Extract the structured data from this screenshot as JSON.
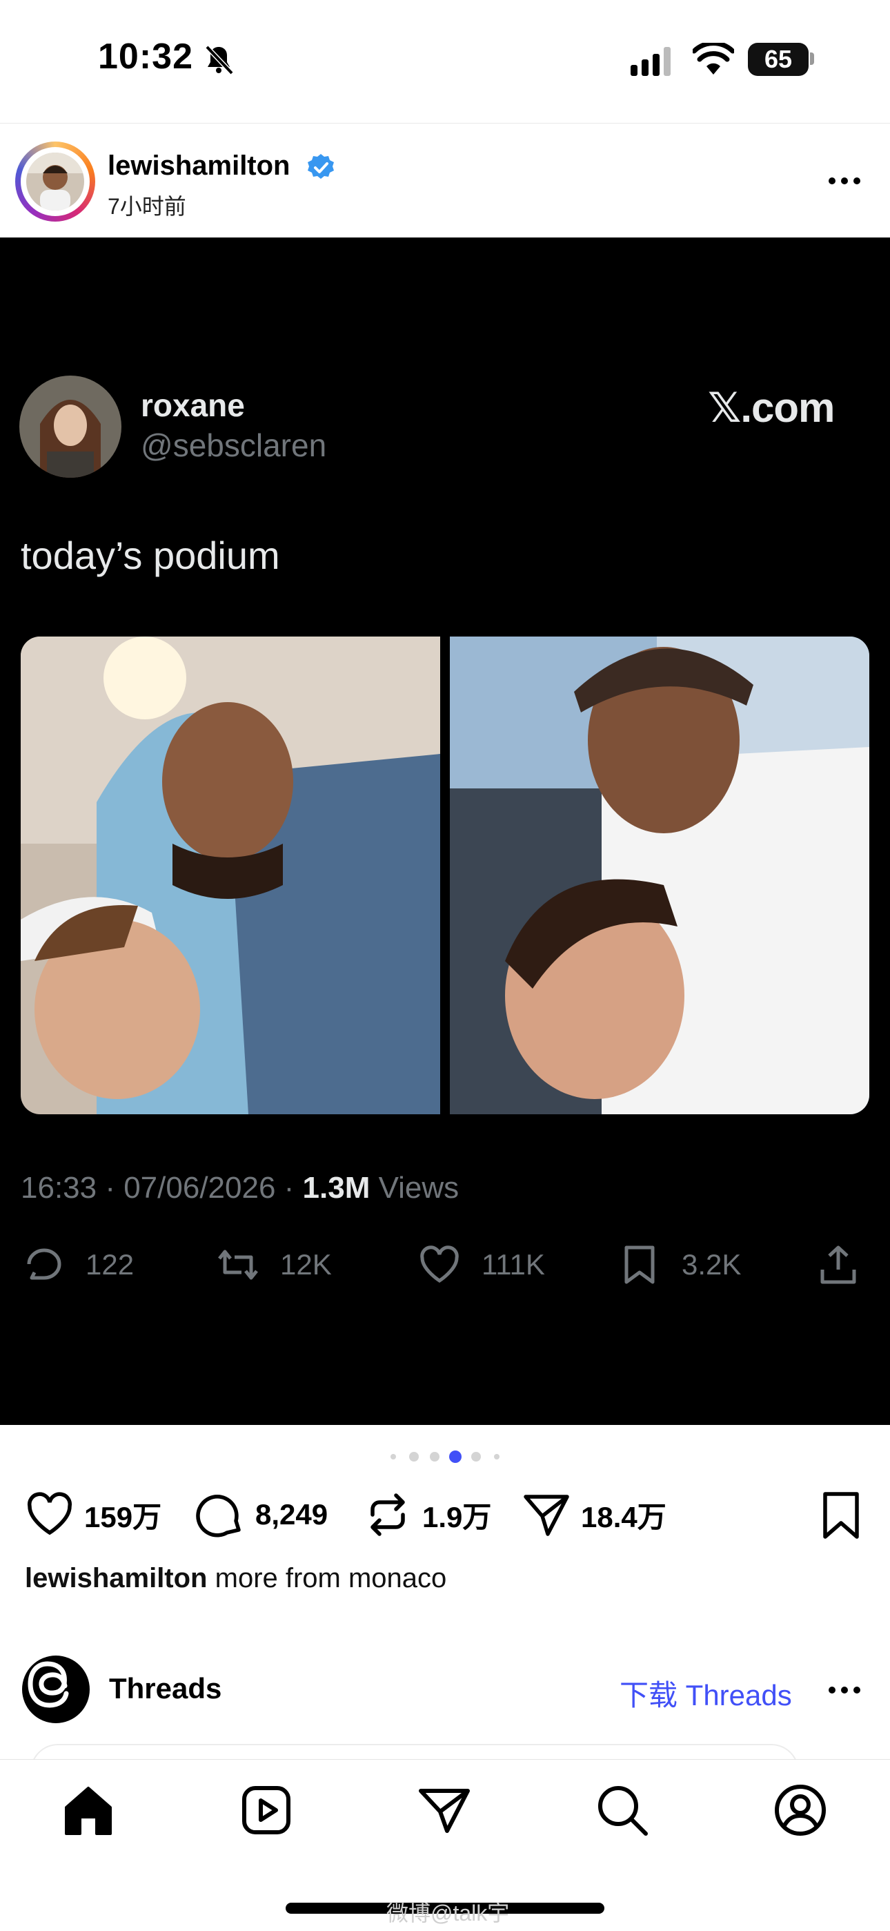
{
  "status_bar": {
    "time": "10:32",
    "battery": "65"
  },
  "post": {
    "author": "lewishamilton",
    "time_ago": "7小时前",
    "caption_author": "lewishamilton",
    "caption_text": "more from monaco"
  },
  "tweet": {
    "name": "roxane",
    "handle": "@sebsclaren",
    "source": "𝕏.com",
    "text": "today’s podium",
    "emojis": "😭😭😭😭😭",
    "meta_time": "16:33 · 07/06/2026 · ",
    "views_count": "1.3M",
    "views_label": " Views",
    "replies": "122",
    "reposts": "12K",
    "likes": "111K",
    "bookmarks": "3.2K"
  },
  "carousel": {
    "total": 6,
    "active_index": 3
  },
  "engagement": {
    "likes": "159万",
    "comments": "8,249",
    "reposts": "1.9万",
    "shares": "18.4万"
  },
  "threads": {
    "label": "Threads",
    "download": "下载 Threads"
  },
  "watermark": "微博@talk宇",
  "icons": {
    "status": [
      "bell-off-icon",
      "cellular-icon",
      "wifi-icon",
      "battery-icon"
    ],
    "tab_bar": [
      "home-icon",
      "reels-icon",
      "send-icon",
      "search-icon",
      "profile-icon"
    ]
  },
  "colors": {
    "tweet_bg": "#000000",
    "verified": "#3897f0",
    "active_dot": "#4150f7",
    "link": "#4150f7"
  }
}
